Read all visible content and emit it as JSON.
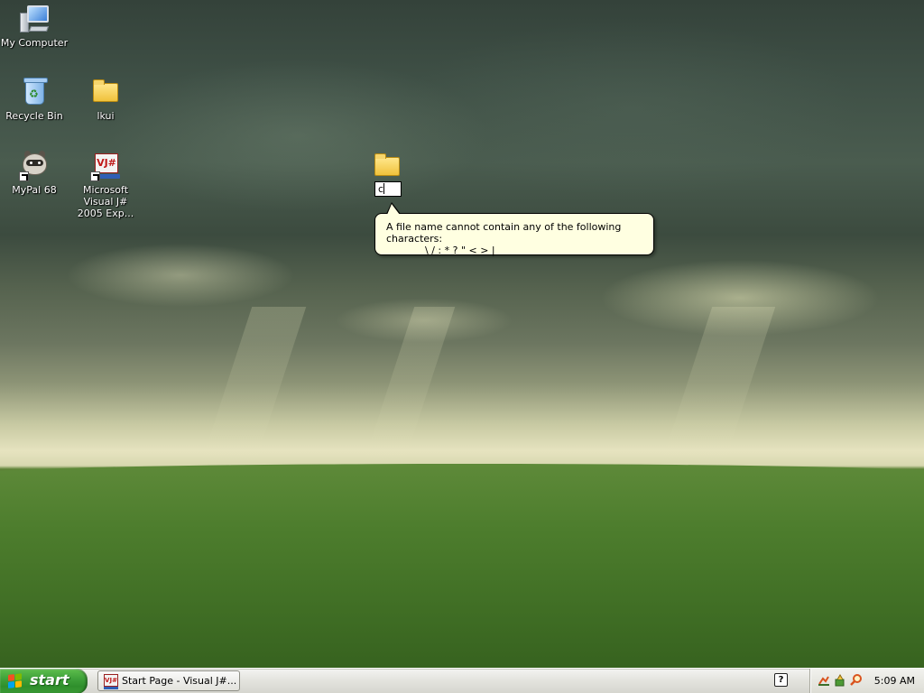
{
  "desktop": {
    "icons": [
      {
        "label": "My Computer",
        "icon": "my-computer-icon"
      },
      {
        "label": "Recycle Bin",
        "icon": "recycle-bin-icon"
      },
      {
        "label": "lkui",
        "icon": "folder-icon"
      },
      {
        "label": "MyPal 68",
        "icon": "mypal-icon",
        "shortcut": true
      },
      {
        "label": "Microsoft Visual J# 2005 Exp...",
        "icon": "visual-j-sharp-icon",
        "shortcut": true
      }
    ],
    "vj_logo_text": "VJ#",
    "renaming_folder": {
      "icon": "folder-icon",
      "rename_value": "c"
    },
    "balloon": {
      "line1": "A file name cannot contain any of the following characters:",
      "line2": "\\ / : * ? \" < > |"
    }
  },
  "taskbar": {
    "start_label": "start",
    "task_buttons": [
      {
        "label": "Start Page - Visual J#...",
        "icon": "visual-j-sharp-icon",
        "icon_text": "VJ#"
      }
    ],
    "help_icon_text": "?",
    "tray": {
      "icons": [
        "network-icon",
        "tools-icon",
        "search-icon"
      ],
      "clock": "5:09 AM"
    }
  },
  "colors": {
    "taskbar_bg": "#e4e4df",
    "start_green": "#3fa13a",
    "balloon_bg": "#ffffe1",
    "sky_dark": "#3f5046",
    "grass": "#4f7a2d"
  }
}
